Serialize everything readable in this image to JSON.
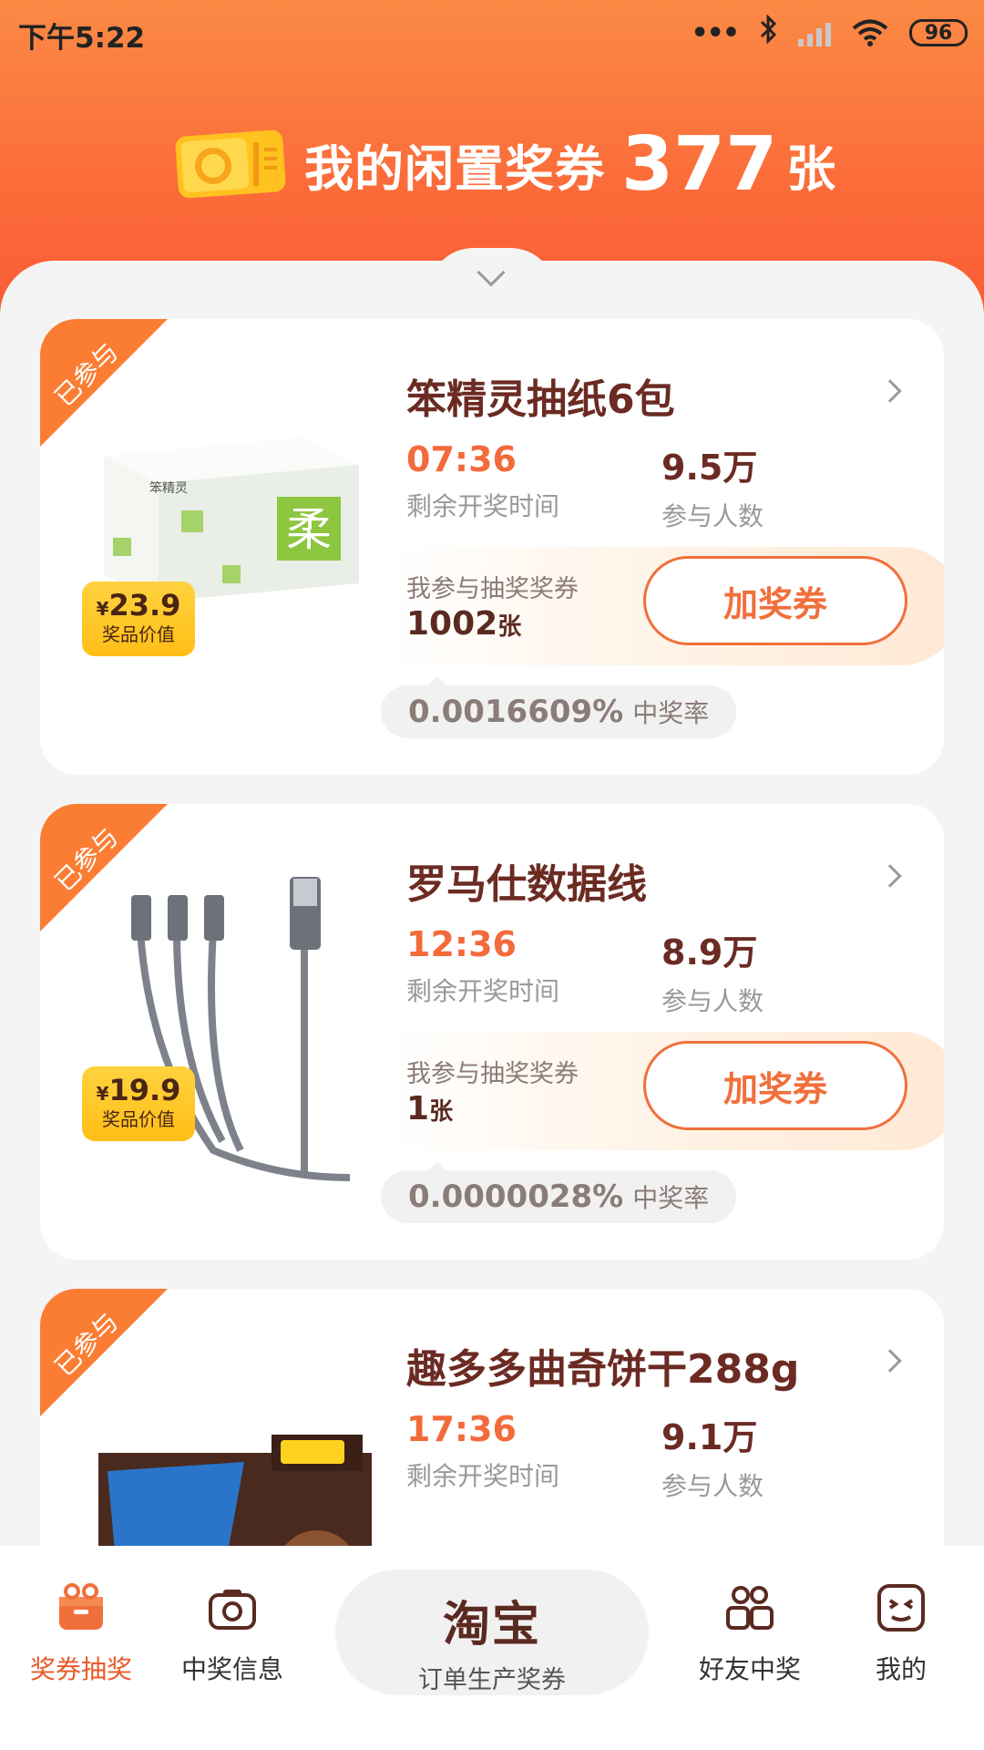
{
  "status_bar": {
    "time": "下午5:22",
    "battery": "96"
  },
  "hero": {
    "label": "我的闲置奖券",
    "count": "377",
    "unit": "张"
  },
  "cards": [
    {
      "badge": "已参与",
      "title": "笨精灵抽纸6包",
      "price_symbol": "¥",
      "price": "23.9",
      "price_label": "奖品价值",
      "time_value": "07:36",
      "time_label": "剩余开奖时间",
      "people_value": "9.5万",
      "people_label": "参与人数",
      "ticket_label": "我参与抽奖奖券",
      "ticket_count": "1002",
      "ticket_unit": "张",
      "button": "加奖券",
      "rate": "0.0016609%",
      "rate_label": "中奖率"
    },
    {
      "badge": "已参与",
      "title": "罗马仕数据线",
      "price_symbol": "¥",
      "price": "19.9",
      "price_label": "奖品价值",
      "time_value": "12:36",
      "time_label": "剩余开奖时间",
      "people_value": "8.9万",
      "people_label": "参与人数",
      "ticket_label": "我参与抽奖奖券",
      "ticket_count": "1",
      "ticket_unit": "张",
      "button": "加奖券",
      "rate": "0.0000028%",
      "rate_label": "中奖率"
    },
    {
      "badge": "已参与",
      "title": "趣多多曲奇饼干288g",
      "time_value": "17:36",
      "time_label": "剩余开奖时间",
      "people_value": "9.1万",
      "people_label": "参与人数"
    }
  ],
  "tabbar": {
    "tab1": "奖券抽奖",
    "tab2": "中奖信息",
    "center_brand": "淘宝",
    "center_label": "订单生产奖券",
    "tab4": "好友中奖",
    "tab5": "我的"
  },
  "colors": {
    "accent": "#f0703c",
    "header": "#fb6a39",
    "price_tag": "#ffc21f"
  }
}
